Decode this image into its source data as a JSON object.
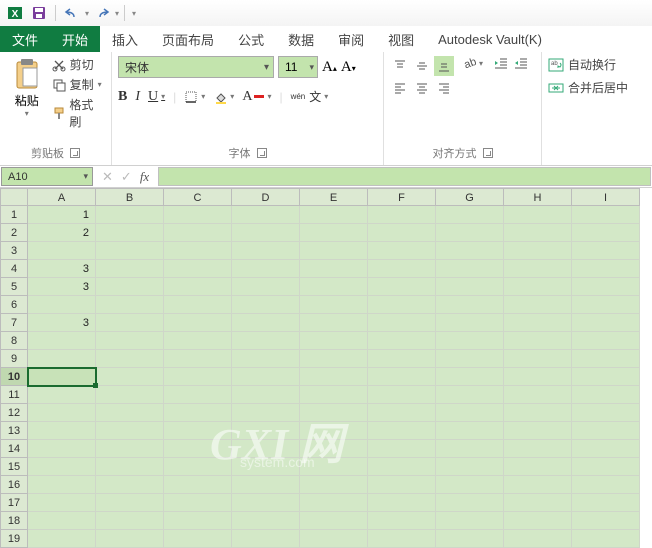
{
  "menu": {
    "file": "文件",
    "tabs": [
      "开始",
      "插入",
      "页面布局",
      "公式",
      "数据",
      "审阅",
      "视图",
      "Autodesk Vault(K)"
    ],
    "active_index": 0
  },
  "ribbon": {
    "clipboard": {
      "title": "剪贴板",
      "paste": "粘贴",
      "cut": "剪切",
      "copy": "复制",
      "format_painter": "格式刷"
    },
    "font": {
      "title": "字体",
      "name": "宋体",
      "size": "11",
      "pinyin": "wén"
    },
    "alignment": {
      "title": "对齐方式"
    },
    "merge": {
      "wrap": "自动换行",
      "merge": "合并后居中"
    }
  },
  "namebox": "A10",
  "columns": [
    "A",
    "B",
    "C",
    "D",
    "E",
    "F",
    "G",
    "H",
    "I"
  ],
  "row_count": 19,
  "active_row": 10,
  "active_col": 0,
  "chart_data": {
    "type": "table",
    "title": "",
    "columns": [
      "A"
    ],
    "rows": [
      {
        "row": 1,
        "A": "1"
      },
      {
        "row": 2,
        "A": "2"
      },
      {
        "row": 3,
        "A": ""
      },
      {
        "row": 4,
        "A": "3"
      },
      {
        "row": 5,
        "A": "3"
      },
      {
        "row": 6,
        "A": ""
      },
      {
        "row": 7,
        "A": "3"
      },
      {
        "row": 8,
        "A": ""
      },
      {
        "row": 9,
        "A": ""
      },
      {
        "row": 10,
        "A": ""
      }
    ]
  },
  "watermark": {
    "big": "GXI 网",
    "small": "system.com"
  }
}
